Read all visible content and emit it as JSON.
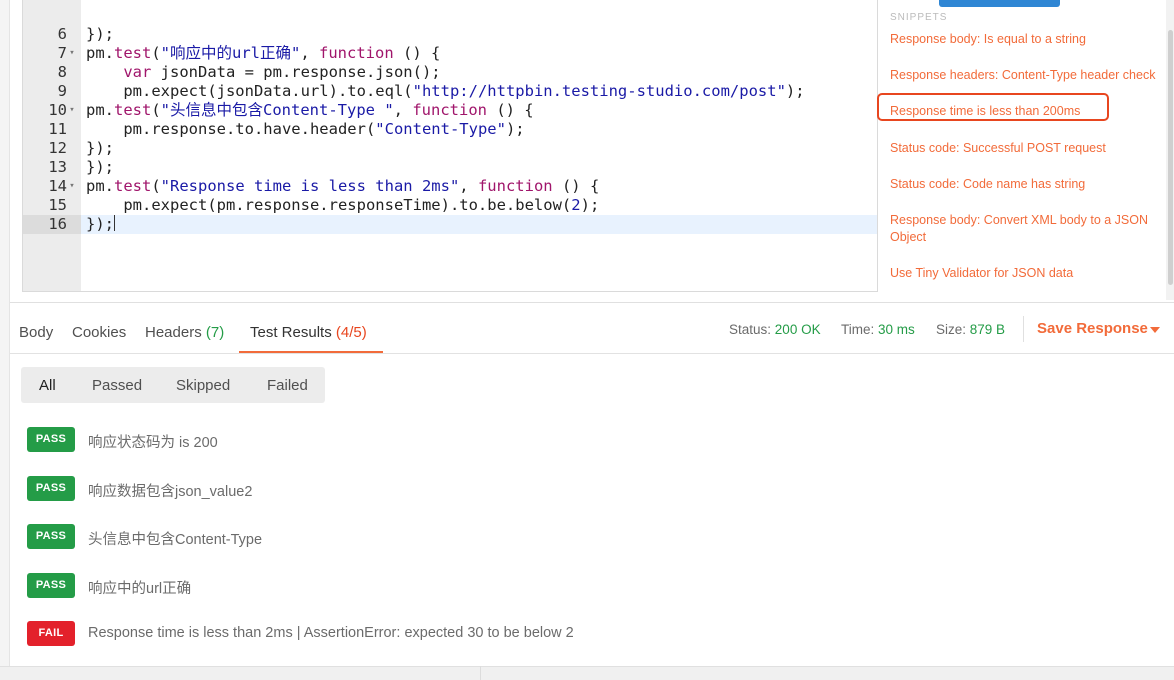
{
  "editor": {
    "lines": [
      {
        "num": "6",
        "fold": "",
        "segments": [
          {
            "t": "});",
            "c": ""
          }
        ]
      },
      {
        "num": "7",
        "fold": "▾",
        "segments": [
          {
            "t": "pm.",
            "c": ""
          },
          {
            "t": "test",
            "c": "fn"
          },
          {
            "t": "(",
            "c": ""
          },
          {
            "t": "\"响应中的url正确\"",
            "c": "str"
          },
          {
            "t": ", ",
            "c": ""
          },
          {
            "t": "function",
            "c": "kw"
          },
          {
            "t": " () {",
            "c": ""
          }
        ]
      },
      {
        "num": "8",
        "fold": "",
        "segments": [
          {
            "t": "    ",
            "c": ""
          },
          {
            "t": "var",
            "c": "kw"
          },
          {
            "t": " jsonData = pm.response.json();",
            "c": ""
          }
        ]
      },
      {
        "num": "9",
        "fold": "",
        "segments": [
          {
            "t": "    pm.expect(jsonData.url).to.eql(",
            "c": ""
          },
          {
            "t": "\"http://httpbin.testing-studio.com/post\"",
            "c": "str"
          },
          {
            "t": ");",
            "c": ""
          }
        ]
      },
      {
        "num": "10",
        "fold": "▾",
        "segments": [
          {
            "t": "pm.",
            "c": ""
          },
          {
            "t": "test",
            "c": "fn"
          },
          {
            "t": "(",
            "c": ""
          },
          {
            "t": "\"头信息中包含Content-Type \"",
            "c": "str"
          },
          {
            "t": ", ",
            "c": ""
          },
          {
            "t": "function",
            "c": "kw"
          },
          {
            "t": " () {",
            "c": ""
          }
        ]
      },
      {
        "num": "11",
        "fold": "",
        "segments": [
          {
            "t": "    pm.response.to.have.header(",
            "c": ""
          },
          {
            "t": "\"Content-Type\"",
            "c": "str"
          },
          {
            "t": ");",
            "c": ""
          }
        ]
      },
      {
        "num": "12",
        "fold": "",
        "segments": [
          {
            "t": "});",
            "c": ""
          }
        ]
      },
      {
        "num": "13",
        "fold": "",
        "segments": [
          {
            "t": "});",
            "c": ""
          }
        ]
      },
      {
        "num": "14",
        "fold": "▾",
        "segments": [
          {
            "t": "pm.",
            "c": ""
          },
          {
            "t": "test",
            "c": "fn"
          },
          {
            "t": "(",
            "c": ""
          },
          {
            "t": "\"Response time is less than 2ms\"",
            "c": "str"
          },
          {
            "t": ", ",
            "c": ""
          },
          {
            "t": "function",
            "c": "kw"
          },
          {
            "t": " () {",
            "c": ""
          }
        ]
      },
      {
        "num": "15",
        "fold": "",
        "segments": [
          {
            "t": "    pm.expect(pm.response.responseTime).to.be.below(",
            "c": ""
          },
          {
            "t": "2",
            "c": "vr"
          },
          {
            "t": ");",
            "c": ""
          }
        ]
      },
      {
        "num": "16",
        "fold": "",
        "segments": [
          {
            "t": "});",
            "c": ""
          }
        ]
      }
    ]
  },
  "snippets": {
    "header": "SNIPPETS",
    "items": [
      "Response body: Is equal to a string",
      "Response headers: Content-Type header check",
      "Response time is less than 200ms",
      "Status code: Successful POST request",
      "Status code: Code name has string",
      "Response body: Convert XML body to a JSON Object",
      "Use Tiny Validator for JSON data"
    ]
  },
  "response": {
    "tabs": {
      "body": "Body",
      "cookies": "Cookies",
      "headers": "Headers",
      "headers_count": "(7)",
      "test_results": "Test Results",
      "test_results_count": "(4/5)"
    },
    "status_label": "Status:",
    "status_value": "200 OK",
    "time_label": "Time:",
    "time_value": "30 ms",
    "size_label": "Size:",
    "size_value": "879 B",
    "save_label": "Save Response"
  },
  "filters": [
    "All",
    "Passed",
    "Skipped",
    "Failed"
  ],
  "results": [
    {
      "status": "PASS",
      "text": "响应状态码为 is 200"
    },
    {
      "status": "PASS",
      "text": "响应数据包含json_value2"
    },
    {
      "status": "PASS",
      "text": "头信息中包含Content-Type"
    },
    {
      "status": "PASS",
      "text": "响应中的url正确"
    },
    {
      "status": "FAIL",
      "text": "Response time is less than 2ms | AssertionError: expected 30 to be below 2"
    }
  ],
  "colors": {
    "accent": "#f26b3a",
    "pass": "#249c47",
    "fail": "#e3212b",
    "highlight_box": "#e8461f"
  }
}
